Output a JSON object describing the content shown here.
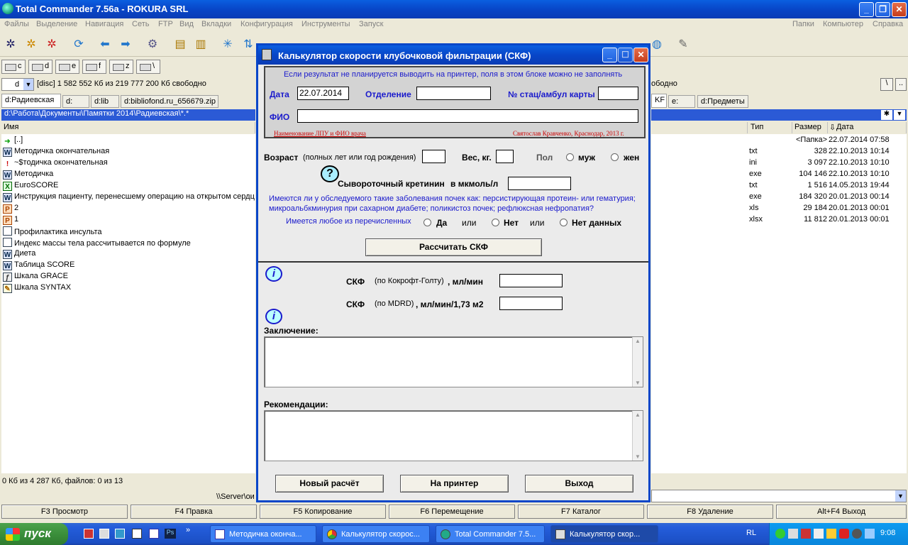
{
  "tc": {
    "title": "Total Commander 7.56a - ROKURA SRL",
    "menu": [
      "Файлы",
      "Выделение",
      "Навигация",
      "Сеть",
      "FTP",
      "Вид",
      "Вкладки",
      "Конфигурация",
      "Инструменты",
      "Запуск"
    ],
    "menu_right": [
      "Папки",
      "Компьютер",
      "Справка"
    ],
    "drives": [
      "c",
      "d",
      "e",
      "f",
      "z",
      "\\"
    ],
    "left_drive": "d",
    "left_drive_info": "[disc]  1 582 552 Кб из 219 777 200 Кб свободно",
    "right_drive_info": "ободно",
    "left_tabs": [
      "d:Радиевская",
      "d:",
      "d:lib",
      "d:bibliofond.ru_656679.zip"
    ],
    "right_tabs": [
      "KF",
      "e:",
      "d:Предметы"
    ],
    "left_path": "d:\\Работа\\Документы\\Памятки 2014\\Радиевская\\*.*",
    "left_col_name": "Имя",
    "right_cols": {
      "type": "Тип",
      "size": "Размер",
      "date": "Дата"
    },
    "left_files": [
      {
        "name": "[..]",
        "icon": "up"
      },
      {
        "name": "Методичка окончательная",
        "icon": "word"
      },
      {
        "name": "~$тодичка окончательная",
        "icon": "warn"
      },
      {
        "name": "Методичка",
        "icon": "word"
      },
      {
        "name": "EuroSCORE",
        "icon": "excel"
      },
      {
        "name": "Инструкция пациенту, перенесшему операцию на открытом сердц",
        "icon": "word"
      },
      {
        "name": "2",
        "icon": "ppt"
      },
      {
        "name": "1",
        "icon": "ppt"
      },
      {
        "name": "Профилактика инсульта",
        "icon": "doc"
      },
      {
        "name": "Индекс массы тела рассчитывается по формуле",
        "icon": "doc"
      },
      {
        "name": "Диета",
        "icon": "word"
      },
      {
        "name": "Таблица SCORE",
        "icon": "word"
      },
      {
        "name": "Шкала GRACE",
        "icon": "swf"
      },
      {
        "name": "Шкала SYNTAX",
        "icon": "pen"
      }
    ],
    "right_files": [
      {
        "type": "",
        "size": "<Папка>",
        "date": "22.07.2014 07:58"
      },
      {
        "type": "txt",
        "size": "328",
        "date": "22.10.2013 10:14"
      },
      {
        "type": "ini",
        "size": "3 097",
        "date": "22.10.2013 10:10"
      },
      {
        "type": "exe",
        "size": "104 146",
        "date": "22.10.2013 10:10"
      },
      {
        "type": "txt",
        "size": "1 516",
        "date": "14.05.2013 19:44"
      },
      {
        "type": "exe",
        "size": "184 320",
        "date": "20.01.2013 00:14"
      },
      {
        "type": "xls",
        "size": "29 184",
        "date": "20.01.2013 00:01"
      },
      {
        "type": "xlsx",
        "size": "11 812",
        "date": "20.01.2013 00:01"
      }
    ],
    "status_left": "0 Кб из 4 287 Кб, файлов: 0 из 13",
    "cmdline": "\\\\Server\\ои",
    "fkeys": [
      "F3 Просмотр",
      "F4 Правка",
      "F5 Копирование",
      "F6 Перемещение",
      "F7 Каталог",
      "F8 Удаление",
      "Alt+F4 Выход"
    ]
  },
  "calc": {
    "title": "Калькулятор скорости клубочковой фильтрации  (СКФ)",
    "info_note": "Если результат не планируется выводить на принтер, поля в этом блоке можно не заполнять",
    "date_label": "Дата",
    "date_value": "22.07.2014",
    "dept_label": "Отделение",
    "card_label": "№ стац/амбул карты",
    "fio_label": "ФИО",
    "lpu_note": "Наименование ЛПУ и ФИО врача",
    "author": "Святослав Кравченко, Краснодар, 2013 г.",
    "age_label": "Возраст",
    "age_hint": "(полных лет или год рождения)",
    "weight_label": "Вес, кг.",
    "sex_label": "Пол",
    "sex_m": "муж",
    "sex_f": "жен",
    "creat_label": "Сывороточный кретинин",
    "creat_unit": "в мкмоль/л",
    "kidney_q": "Имеются ли у обследуемого такие заболевания почек как: персистирующая протеин- или гематурия; микроальбкминурия при сахарном диабете; поликистоз почек; рефлюксная нефропатия?",
    "any_label": "Имеется любое из перечисленных",
    "yes": "Да",
    "or1": "или",
    "no": "Нет",
    "or2": "или",
    "nodata": "Нет данных",
    "calc_btn": "Рассчитать СКФ",
    "gfr1_label": "СКФ",
    "gfr1_method": "(по Кокрофт-Голту)",
    "gfr1_unit": ", мл/мин",
    "gfr2_label": "СКФ",
    "gfr2_method": "(по MDRD)",
    "gfr2_unit": ", мл/мин/1,73 м2",
    "conclusion_label": "Заключение:",
    "recs_label": "Рекомендации:",
    "btn_new": "Новый расчёт",
    "btn_print": "На принтер",
    "btn_exit": "Выход"
  },
  "taskbar": {
    "start": "пуск",
    "tasks": [
      "Методичка оконча...",
      "Калькулятор скорос...",
      "Total Commander 7.5...",
      "Калькулятор скор..."
    ],
    "lang": "RL",
    "clock": "9:08"
  }
}
